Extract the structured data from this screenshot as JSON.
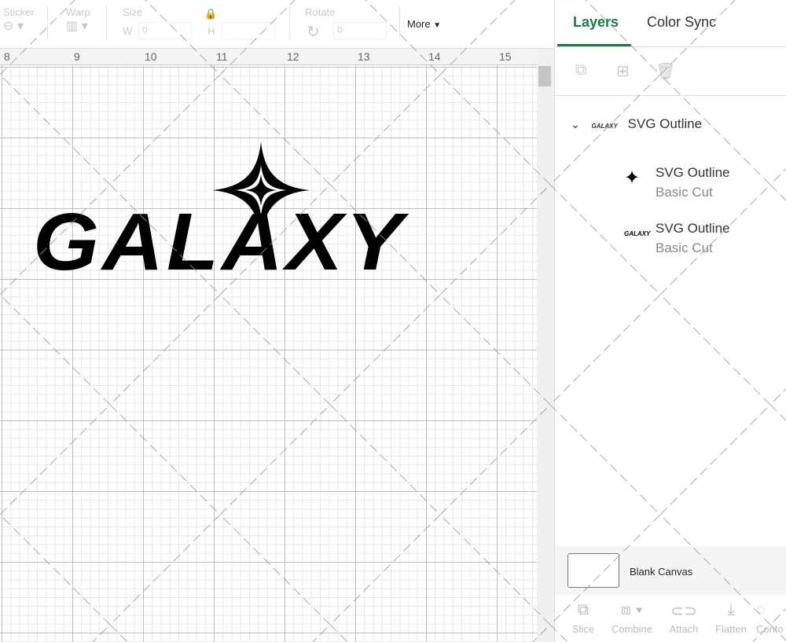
{
  "toolbar": {
    "sticker": "Sticker",
    "warp": "Warp",
    "size": "Size",
    "w_label": "W",
    "w_value": "0",
    "h_label": "H",
    "rotate": "Rotate",
    "rotate_value": "0",
    "more": "More"
  },
  "ruler": {
    "ticks": [
      "8",
      "9",
      "10",
      "11",
      "12",
      "13",
      "14",
      "15"
    ]
  },
  "canvas": {
    "design_text": "GALAXY"
  },
  "panel": {
    "tabs": [
      {
        "label": "Layers",
        "active": true
      },
      {
        "label": "Color Sync",
        "active": false
      }
    ],
    "group": {
      "name": "SVG Outline"
    },
    "layers": [
      {
        "name": "SVG Outline",
        "type": "Basic Cut",
        "icon": "star-thumbnail"
      },
      {
        "name": "SVG Outline",
        "type": "Basic Cut",
        "icon": "galaxy-thumbnail"
      }
    ],
    "blank_canvas": "Blank Canvas",
    "actions": [
      {
        "label": "Slice",
        "icon": "slice-icon"
      },
      {
        "label": "Combine",
        "icon": "combine-icon"
      },
      {
        "label": "Attach",
        "icon": "attach-icon"
      },
      {
        "label": "Flatten",
        "icon": "flatten-icon"
      },
      {
        "label": "Conto",
        "icon": "contour-icon"
      }
    ]
  },
  "colors": {
    "accent": "#1b7a4b"
  }
}
